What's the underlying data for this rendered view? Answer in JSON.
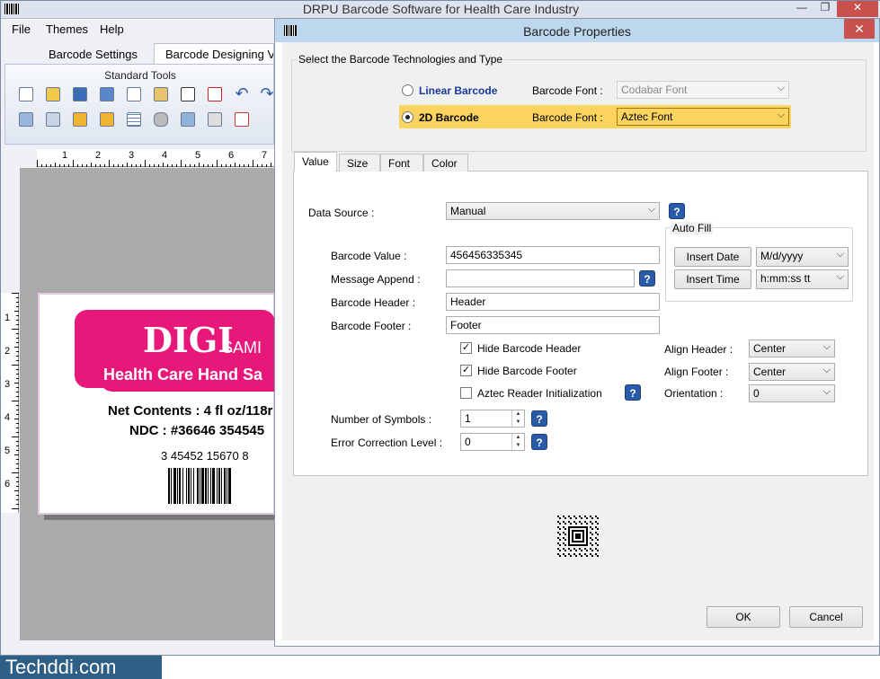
{
  "main": {
    "title": "DRPU Barcode Software for Health Care Industry",
    "menus": [
      "File",
      "Themes",
      "Help"
    ],
    "tabs": [
      "Barcode Settings",
      "Barcode Designing V"
    ],
    "toolbar_label": "Standard Tools",
    "ruler_h": [
      "1",
      "2",
      "3",
      "4",
      "5",
      "6",
      "7"
    ],
    "ruler_v": [
      "1",
      "2",
      "3",
      "4",
      "5",
      "6"
    ]
  },
  "label": {
    "brand": "DIGI",
    "brand_suffix": "SAMI",
    "product": "Health Care Hand Sa",
    "net_contents": "Net Contents : 4 fl oz/118r",
    "ndc": "NDC : #36646 354545",
    "barcode_number": "3  45452   15670  8"
  },
  "dialog": {
    "title": "Barcode Properties",
    "tech_group_label": "Select the Barcode Technologies and Type",
    "linear_label": "Linear Barcode",
    "linear_font_label": "Barcode Font :",
    "linear_font_value": "Codabar Font",
    "twod_label": "2D Barcode",
    "twod_font_label": "Barcode Font :",
    "twod_font_value": "Aztec Font",
    "tabs": [
      "Value",
      "Size",
      "Font",
      "Color"
    ],
    "data_source_label": "Data Source :",
    "data_source_value": "Manual",
    "auto_fill_label": "Auto Fill",
    "insert_date_label": "Insert Date",
    "insert_date_format": "M/d/yyyy",
    "insert_time_label": "Insert Time",
    "insert_time_format": "h:mm:ss tt",
    "barcode_value_label": "Barcode Value :",
    "barcode_value": "456456335345",
    "message_append_label": "Message Append :",
    "message_append_value": "",
    "barcode_header_label": "Barcode Header :",
    "barcode_header_value": "Header",
    "barcode_footer_label": "Barcode Footer :",
    "barcode_footer_value": "Footer",
    "hide_header_label": "Hide Barcode Header",
    "hide_header_checked": true,
    "hide_footer_label": "Hide Barcode Footer",
    "hide_footer_checked": true,
    "aztec_init_label": "Aztec Reader Initialization",
    "aztec_init_checked": false,
    "align_header_label": "Align Header  :",
    "align_header_value": "Center",
    "align_footer_label": "Align Footer  :",
    "align_footer_value": "Center",
    "orientation_label": "Orientation  :",
    "orientation_value": "0",
    "num_symbols_label": "Number of Symbols :",
    "num_symbols_value": "1",
    "error_correction_label": "Error Correction Level :",
    "error_correction_value": "0",
    "ok_label": "OK",
    "cancel_label": "Cancel",
    "help_glyph": "?"
  },
  "footer_watermark": "Techddi.com",
  "colors": {
    "accent_pink": "#e8177a",
    "selected_row": "#fbd35f",
    "help_blue": "#2a5ba8"
  }
}
